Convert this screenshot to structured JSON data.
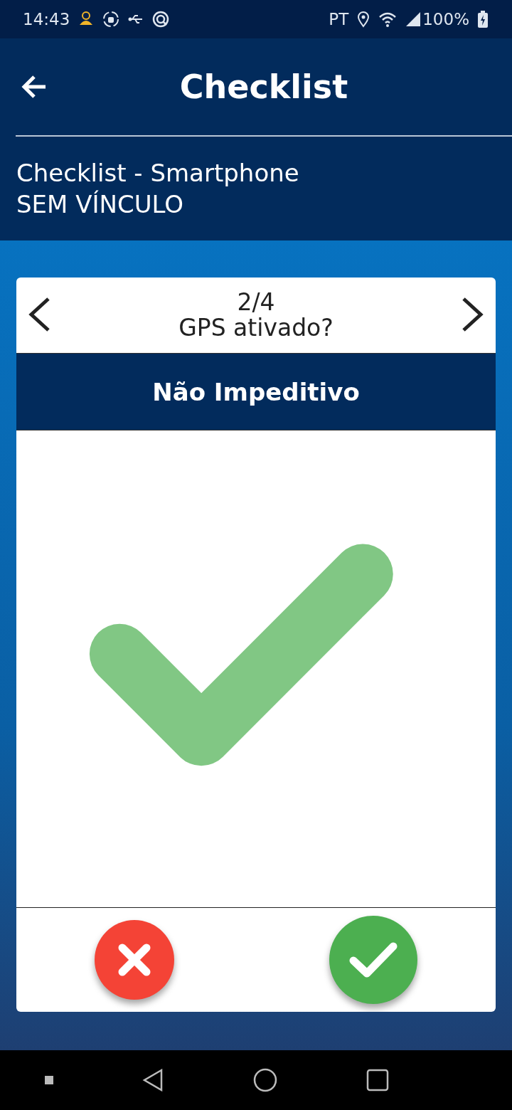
{
  "status_bar": {
    "time": "14:43",
    "carrier": "PT",
    "battery": "100%"
  },
  "header": {
    "title": "Checklist"
  },
  "subtitle": [
    "Checklist - Smartphone",
    "SEM VÍNCULO"
  ],
  "card": {
    "counter": "2/4",
    "question": "GPS ativado?",
    "category": "Não Impeditivo",
    "approved": true
  }
}
